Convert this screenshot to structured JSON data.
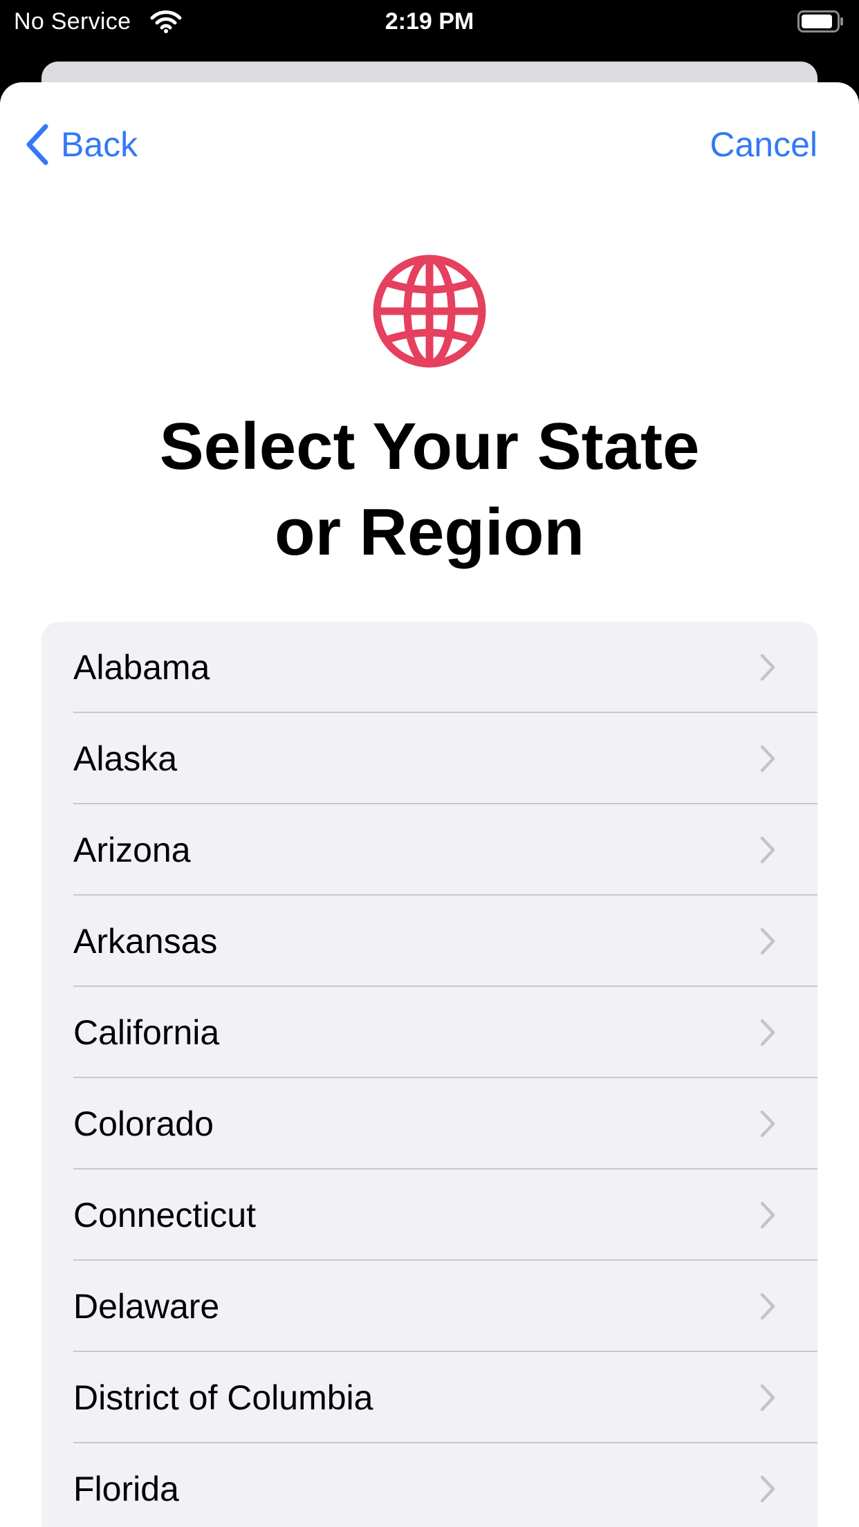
{
  "status_bar": {
    "carrier": "No Service",
    "time": "2:19 PM"
  },
  "nav": {
    "back_label": "Back",
    "cancel_label": "Cancel"
  },
  "header": {
    "icon": "globe-icon",
    "title_line1": "Select Your State",
    "title_line2": "or Region"
  },
  "regions": [
    "Alabama",
    "Alaska",
    "Arizona",
    "Arkansas",
    "California",
    "Colorado",
    "Connecticut",
    "Delaware",
    "District of Columbia",
    "Florida"
  ],
  "colors": {
    "accent": "#3478f6",
    "globe": "#e5405e",
    "list_background": "#f1f1f6"
  }
}
